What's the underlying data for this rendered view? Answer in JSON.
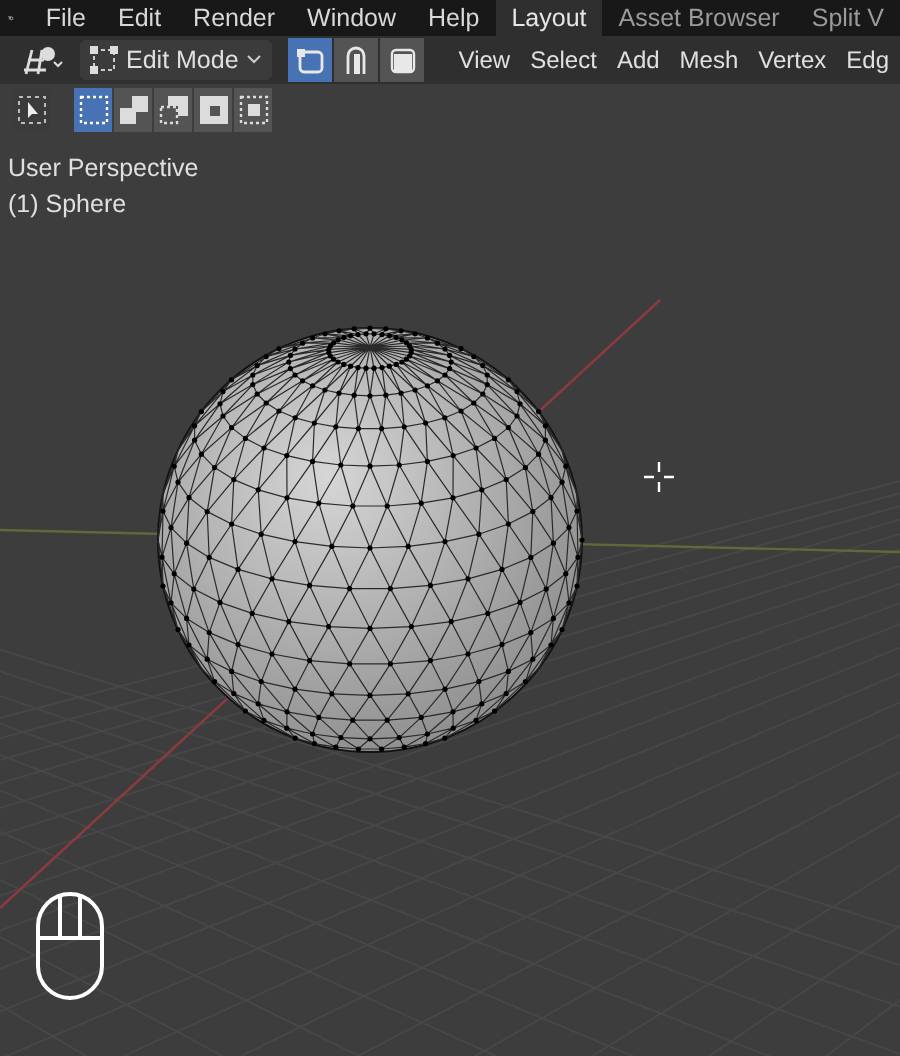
{
  "menubar": {
    "menus": [
      "File",
      "Edit",
      "Render",
      "Window",
      "Help"
    ]
  },
  "workspace_tabs": [
    {
      "label": "Layout",
      "selected": true
    },
    {
      "label": "Asset Browser",
      "selected": false
    },
    {
      "label": "Split V",
      "selected": false
    }
  ],
  "header": {
    "mode": "Edit Mode",
    "select_modes": [
      {
        "kind": "vertex",
        "selected": true
      },
      {
        "kind": "edge",
        "selected": false
      },
      {
        "kind": "face",
        "selected": false
      }
    ],
    "menus": [
      "View",
      "Select",
      "Add",
      "Mesh",
      "Vertex",
      "Edg"
    ]
  },
  "toolbar": {
    "select_box_modes": [
      {
        "kind": "new",
        "selected": true
      },
      {
        "kind": "extend",
        "selected": false
      },
      {
        "kind": "subtract",
        "selected": false
      },
      {
        "kind": "difference",
        "selected": false
      },
      {
        "kind": "intersect",
        "selected": false
      }
    ]
  },
  "viewport": {
    "view_name": "User Perspective",
    "object_name": "(1) Sphere"
  }
}
